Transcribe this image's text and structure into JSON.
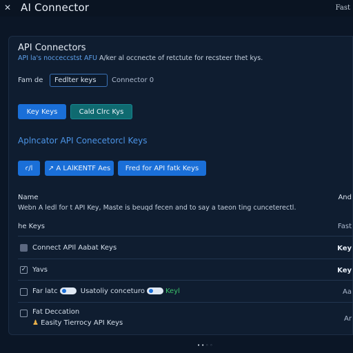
{
  "window": {
    "title": "AI Connector",
    "right_label": "Fast"
  },
  "header": {
    "title": "API Connectors",
    "desc_link": "API la's nocceccstst AFU",
    "desc_text": " A/ker al occnecte of retctute for recsteer thet kys."
  },
  "form": {
    "label": "Fam de",
    "input_value": "Fedlter keys",
    "count": "Connector 0"
  },
  "buttons_row1": [
    {
      "label": "Key Keys",
      "style": "blue"
    },
    {
      "label": "Cald Clrc Kys",
      "style": "teal"
    }
  ],
  "section": {
    "title_prefix": "Aplncator API",
    "title_link": "Conecetorcl Keys"
  },
  "buttons_row2": [
    {
      "label": "ꜥ/l",
      "style": "blue"
    },
    {
      "label": "↗ A LAlKENTF Aes",
      "style": "blue"
    },
    {
      "label": "Fred for API fatk Keys",
      "style": "blue"
    }
  ],
  "table": {
    "col_name": "Name",
    "col_right": "And",
    "description": "Webn A ledl for t API Key, Maste is beuqd fecen and to say a taeon ting cunceterectl.",
    "rows": [
      {
        "label": "he  Keys",
        "right": "Fast",
        "checkbox": "none"
      },
      {
        "label": "Connect APIl Aabat Keys",
        "right": "Key",
        "checkbox": "filled"
      },
      {
        "label": "Yavs",
        "right": "Key",
        "checkbox": "checked"
      },
      {
        "label_a": "Far latc",
        "label_b": "Usatoliy conceturo",
        "label_c": "Keyl",
        "right": "Aa",
        "checkbox": "empty"
      },
      {
        "label": "Fat Deccation",
        "sub": "Easity Tierrocy API Keys",
        "right": "Ar",
        "checkbox": "empty"
      }
    ]
  },
  "pagination": {
    "dots": [
      "•",
      "•",
      "◦",
      "◦"
    ]
  },
  "colors": {
    "accent": "#1a6fd8",
    "teal": "#0f6a70",
    "link": "#4c95e8",
    "bg": "#0b1626",
    "green": "#3cc26b"
  },
  "icons": {
    "close": "close-icon",
    "checkmark": "check-icon",
    "user": "user-icon",
    "resize": "resize-icon"
  }
}
